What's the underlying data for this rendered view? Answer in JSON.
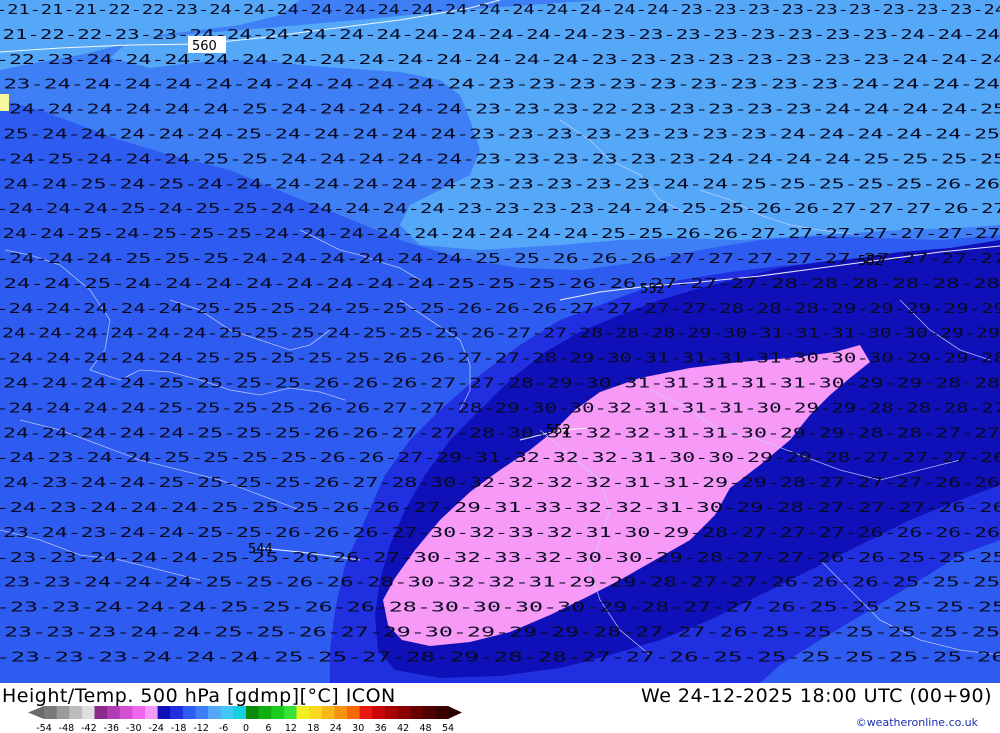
{
  "header": {
    "title": "Height/Temp. 500 hPa [gdmp][°C] ICON",
    "datetime": "We 24-12-2025 18:00 UTC (00+90)",
    "credit": "©weatheronline.co.uk"
  },
  "map": {
    "height_labels": [
      "560",
      "552",
      "552",
      "552",
      "544",
      "544"
    ],
    "isotherm_rows": [
      "-21-21-21-22-22-23-24-24-24-24-24-24-24-24-24-24-24-24-24-24-23-23-23-23-23-23-23-23-23-24",
      "-21-22-22-23-23-24-24-24-24-24-24-24-24-24-24-24-23-23-23-23-23-23-23-23-24-24-24",
      "-22-23-24-24-24-24-24-24-24-24-24-24-24-24-24-23-23-23-23-23-23-23-23-24-24-24",
      "-23-24-24-24-24-24-24-24-24-24-24-24-23-23-23-23-23-23-23-23-23-24-24-24-24",
      "-24-24-24-24-24-24-25-24-24-24-24-24-23-23-23-22-23-23-23-23-23-24-24-24-24-25",
      "-25-24-24-24-24-24-25-24-24-24-24-24-23-23-23-23-23-23-23-23-24-24-24-24-24-25",
      "-24-25-24-24-24-25-25-24-24-24-24-24-23-23-23-23-23-23-24-24-24-24-25-25-25-25",
      "-24-24-25-24-25-24-24-24-24-24-24-24-23-23-23-23-23-24-24-25-25-25-25-25-26-26",
      "-24-24-24-25-24-25-25-24-24-24-24-24-23-23-23-23-24-24-25-25-26-26-27-27-27-26-27",
      "-24-24-25-24-25-25-25-24-24-24-24-24-24-24-24-24-25-25-26-26-27-27-27-27-27-27-27",
      "-24-24-24-25-25-25-24-24-24-24-24-24-25-25-26-26-26-27-27-27-27-27-27-27-27-27",
      "-24-24-25-24-24-24-24-24-24-24-24-25-25-25-26-26-27-27-27-28-28-28-28-28-28",
      "-24-24-24-24-24-25-25-25-24-25-25-25-26-26-26-27-27-27-27-28-28-28-29-29-29-29-29",
      "-24-24-24-24-24-24-25-25-25-24-25-25-25-26-27-27-28-28-28-29-30-31-31-31-30-30-29-29",
      "-24-24-24-24-24-25-25-25-25-25-26-26-27-27-28-29-30-31-31-31-31-30-30-30-29-29-28",
      "-24-24-24-24-25-25-25-25-26-26-26-27-27-28-29-30-31-31-31-31-31-30-29-29-28-28",
      "-24-24-24-24-25-25-25-25-26-26-27-27-28-29-30-30-32-31-31-31-30-29-29-28-28-28-27",
      "-24-24-24-24-24-25-25-25-26-26-27-27-28-30-31-32-32-31-31-30-29-29-28-28-27-27",
      "-24-23-24-24-25-25-25-25-26-26-27-29-31-32-32-32-31-30-30-29-29-28-27-27-27-26",
      "-24-23-24-24-25-25-25-25-26-27-28-30-32-32-32-32-31-31-29-29-28-27-27-27-26-26",
      "-24-23-24-24-24-25-25-25-26-26-27-29-31-33-32-32-31-30-29-28-27-27-27-26-26",
      "-23-24-23-24-24-25-25-26-26-26-27-30-32-33-32-31-30-29-28-27-27-27-26-26-26-26",
      "-23-23-24-24-24-25-25-26-26-27-30-32-33-32-30-30-29-28-27-27-26-26-25-25-25",
      "-23-23-24-24-24-25-25-26-26-28-30-32-32-31-29-29-28-27-27-26-26-26-25-25-25",
      "-23-23-24-24-24-25-25-26-26-28-30-30-30-30-29-28-27-27-26-25-25-25-25-25",
      "-23-23-23-24-24-25-25-26-27-29-30-29-29-29-28-27-27-26-25-25-25-25-25-25",
      "-23-23-23-24-24-24-25-25-27-28-29-28-28-27-27-26-25-25-25-25-25-25-26"
    ]
  },
  "legend": {
    "ticks": [
      "-54",
      "-48",
      "-42",
      "-36",
      "-30",
      "-24",
      "-18",
      "-12",
      "-6",
      "0",
      "6",
      "12",
      "18",
      "24",
      "30",
      "36",
      "42",
      "48",
      "54"
    ],
    "colors": [
      "#7a7a7a",
      "#9a9a9a",
      "#bcbcbc",
      "#dedede",
      "#8b2a8b",
      "#b23ab2",
      "#d24fd2",
      "#ee66ee",
      "#f79af7",
      "#1010b8",
      "#2030e0",
      "#2f5cf0",
      "#3f7ff5",
      "#55a8f8",
      "#3fc8f5",
      "#13d0e0",
      "#0a8a0a",
      "#0fae0f",
      "#1ccc1c",
      "#38e038",
      "#f0f020",
      "#f8d820",
      "#f8b818",
      "#f89010",
      "#f86808",
      "#e81810",
      "#c80808",
      "#a80000",
      "#880000",
      "#680000",
      "#500000",
      "#380000"
    ]
  }
}
